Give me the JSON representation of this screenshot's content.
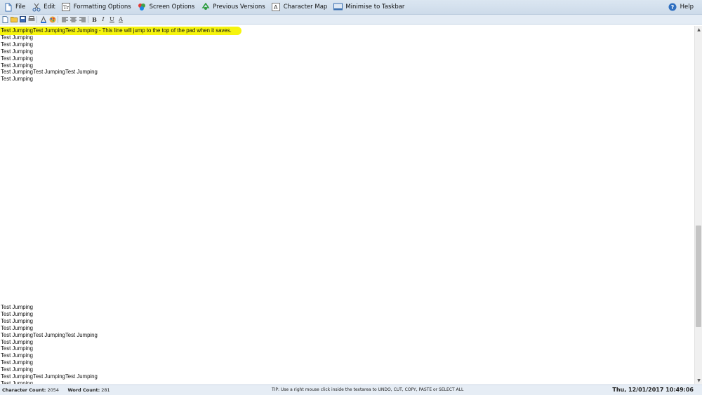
{
  "menubar": {
    "items": [
      {
        "label": "File",
        "icon": "file-icon"
      },
      {
        "label": "Edit",
        "icon": "scissors-icon"
      },
      {
        "label": "Formatting Options",
        "icon": "formatting-icon"
      },
      {
        "label": "Screen Options",
        "icon": "palette-icon"
      },
      {
        "label": "Previous Versions",
        "icon": "recycle-icon"
      },
      {
        "label": "Character Map",
        "icon": "character-map-icon"
      },
      {
        "label": "Minimise to Taskbar",
        "icon": "taskbar-icon"
      }
    ],
    "help_label": "Help"
  },
  "toolbar": {
    "bold": "B",
    "italic": "I",
    "underline": "U",
    "font": "A"
  },
  "pad": {
    "top_lines": [
      "Test JumpingTest JumpingTest Jumping - This line will jump to the top of the pad when it saves.",
      "Test Jumping",
      "Test Jumping",
      "Test Jumping",
      "Test Jumping",
      "Test Jumping",
      "Test JumpingTest JumpingTest Jumping",
      "Test Jumping"
    ],
    "bottom_lines": [
      "Test Jumping",
      "Test Jumping",
      "Test Jumping",
      "Test Jumping",
      "Test JumpingTest JumpingTest Jumping",
      "Test Jumping",
      "Test Jumping",
      "Test Jumping",
      "Test Jumping",
      "Test Jumping",
      "Test JumpingTest JumpingTest Jumping",
      "Test Jumping"
    ],
    "highlight_color": "#f5f300"
  },
  "status": {
    "char_label": "Character Count:",
    "char_value": "2054",
    "word_label": "Word Count:",
    "word_value": "281",
    "tip": "TIP: Use a right mouse click inside the textarea to UNDO, CUT, COPY, PASTE or SELECT ALL",
    "clock": "Thu, 12/01/2017   10:49:06"
  }
}
